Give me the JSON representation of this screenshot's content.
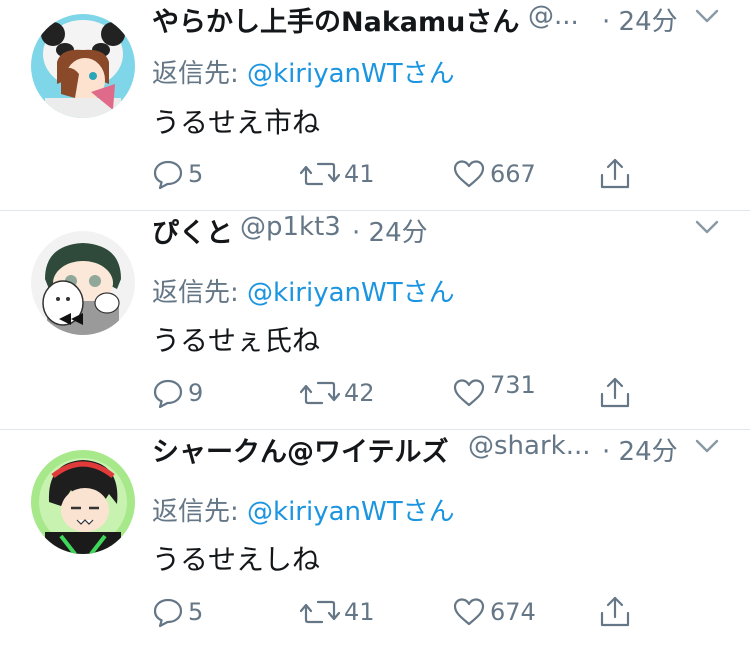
{
  "reply_prefix": "返信先:",
  "tweets": [
    {
      "name": "やらかし上手のNakamuさん",
      "handle": "@...",
      "time": "· 24分",
      "reply_to": "@kiriyanWTさん",
      "text": "うるせえ市ね",
      "replies": "5",
      "retweets": "41",
      "likes": "667"
    },
    {
      "name": "ぴくと",
      "handle": "@p1kt3",
      "time": "· 24分",
      "reply_to": "@kiriyanWTさん",
      "text": "うるせぇ氏ね",
      "replies": "9",
      "retweets": "42",
      "likes": "731"
    },
    {
      "name": "シャークん@ワイテルズ",
      "handle": "@shark...",
      "time": "· 24分",
      "reply_to": "@kiriyanWTさん",
      "text": "うるせえしね",
      "replies": "5",
      "retweets": "41",
      "likes": "674"
    }
  ],
  "icons": {
    "reply": "reply-icon",
    "retweet": "retweet-icon",
    "like": "heart-icon",
    "share": "share-icon",
    "menu": "chevron-down-icon"
  },
  "colors": {
    "text": "#14171a",
    "secondary": "#657786",
    "link": "#1b95e0",
    "divider": "#e1e8ed"
  }
}
